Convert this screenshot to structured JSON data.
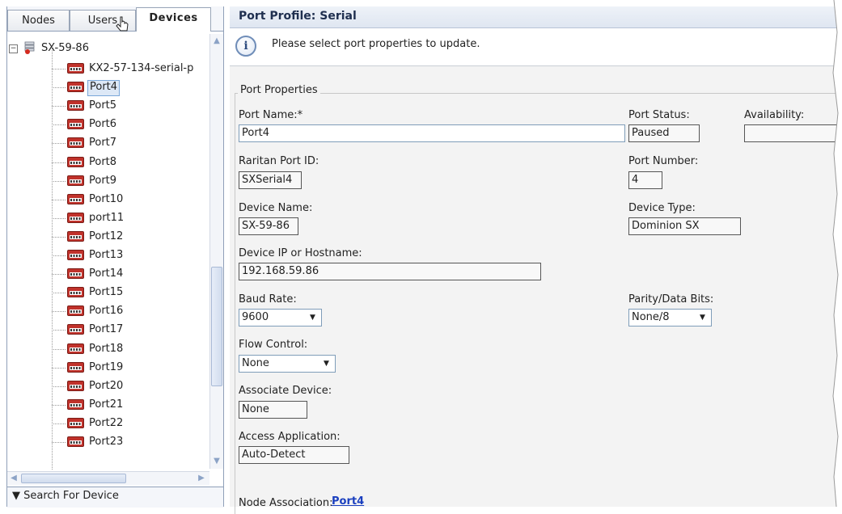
{
  "tabs": [
    {
      "label": "Nodes",
      "active": false
    },
    {
      "label": "Users",
      "active": false
    },
    {
      "label": "Devices",
      "active": true
    }
  ],
  "tree": {
    "root": {
      "label": "SX-59-86",
      "expanded": true,
      "expander": "⊟"
    },
    "children": [
      {
        "label": "KX2-57-134-serial-p",
        "selected": false
      },
      {
        "label": "Port4",
        "selected": true
      },
      {
        "label": "Port5",
        "selected": false
      },
      {
        "label": "Port6",
        "selected": false
      },
      {
        "label": "Port7",
        "selected": false
      },
      {
        "label": "Port8",
        "selected": false
      },
      {
        "label": "Port9",
        "selected": false
      },
      {
        "label": "Port10",
        "selected": false
      },
      {
        "label": "port11",
        "selected": false
      },
      {
        "label": "Port12",
        "selected": false
      },
      {
        "label": "Port13",
        "selected": false
      },
      {
        "label": "Port14",
        "selected": false
      },
      {
        "label": "Port15",
        "selected": false
      },
      {
        "label": "Port16",
        "selected": false
      },
      {
        "label": "Port17",
        "selected": false
      },
      {
        "label": "Port18",
        "selected": false
      },
      {
        "label": "Port19",
        "selected": false
      },
      {
        "label": "Port20",
        "selected": false
      },
      {
        "label": "Port21",
        "selected": false
      },
      {
        "label": "Port22",
        "selected": false
      },
      {
        "label": "Port23",
        "selected": false
      }
    ]
  },
  "search": {
    "label": "▼ Search For Device"
  },
  "header": {
    "title": "Port Profile: Serial"
  },
  "info": {
    "icon": "info-icon",
    "message": "Please select port properties to update."
  },
  "form": {
    "legend": "Port Properties",
    "port_name": {
      "label": "Port Name:*",
      "value": "Port4"
    },
    "port_status": {
      "label": "Port Status:",
      "value": "Paused"
    },
    "availability": {
      "label": "Availability:",
      "value": ""
    },
    "raritan_port_id": {
      "label": "Raritan Port ID:",
      "value": "SXSerial4"
    },
    "port_number": {
      "label": "Port Number:",
      "value": "4"
    },
    "device_name": {
      "label": "Device Name:",
      "value": "SX-59-86"
    },
    "device_type": {
      "label": "Device Type:",
      "value": "Dominion SX"
    },
    "device_ip": {
      "label": "Device IP or Hostname:",
      "value": "192.168.59.86"
    },
    "baud_rate": {
      "label": "Baud Rate:",
      "value": "9600"
    },
    "parity": {
      "label": "Parity/Data Bits:",
      "value": "None/8"
    },
    "flow_control": {
      "label": "Flow Control:",
      "value": "None"
    },
    "associate_device": {
      "label": "Associate Device:",
      "value": "None"
    },
    "access_app": {
      "label": "Access Application:",
      "value": "Auto-Detect"
    },
    "node_association": {
      "label": "Node Association:",
      "link": "Port4"
    }
  },
  "colors": {
    "accent": "#1a3fbf",
    "header_bg": "#dfe6f1",
    "selection": "#dde8f6",
    "port_icon": "#c0322b"
  }
}
